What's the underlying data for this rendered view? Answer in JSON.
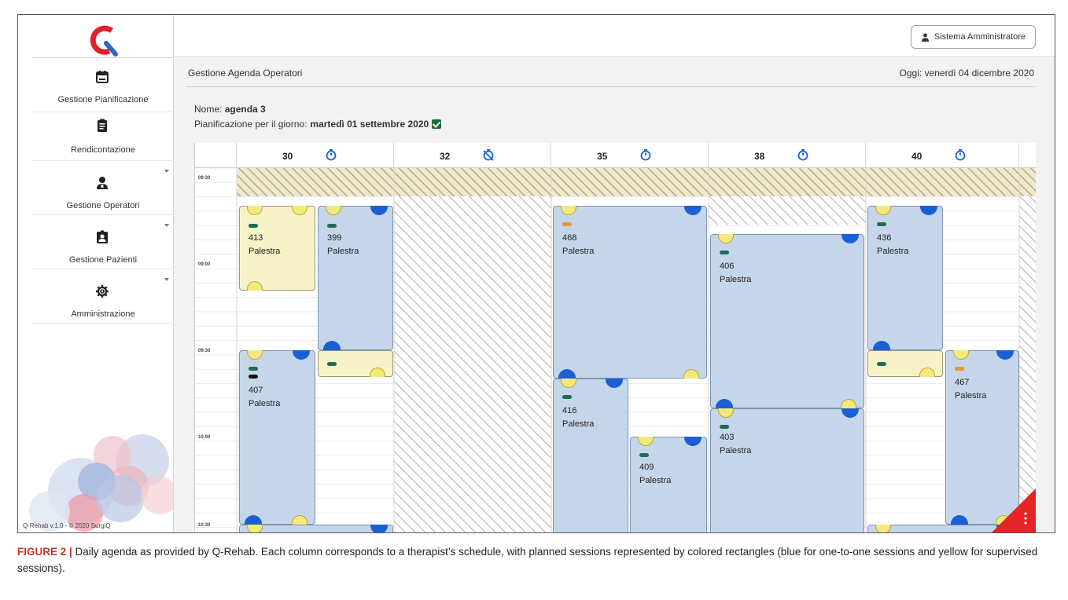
{
  "app": {
    "admin_button": "Sistema Amministratore"
  },
  "sidebar": {
    "items": [
      {
        "label": "Gestione Pianificazione",
        "icon": "calendar-icon",
        "has_caret": false
      },
      {
        "label": "Rendicontazione",
        "icon": "clipboard-icon",
        "has_caret": false
      },
      {
        "label": "Gestione Operatori",
        "icon": "operator-icon",
        "has_caret": true
      },
      {
        "label": "Gestione Pazienti",
        "icon": "patient-badge-icon",
        "has_caret": true
      },
      {
        "label": "Amministrazione",
        "icon": "gear-icon",
        "has_caret": true
      }
    ],
    "footer": "Q-Rehab v.1.0 - © 2020 SurgiQ"
  },
  "header": {
    "title": "Gestione Agenda Operatori",
    "today": "Oggi: venerdì 04 dicembre 2020"
  },
  "agenda": {
    "name_label": "Nome:",
    "name_value": "agenda 3",
    "plan_label": "Pianificazione per il giorno:",
    "plan_value": "martedì 01 settembre 2020",
    "times": [
      "09:30",
      "09:00",
      "09:30",
      "10:00",
      "10:30"
    ],
    "columns": [
      {
        "number": "30",
        "timer": "timer-icon"
      },
      {
        "number": "32",
        "timer": "timer-off-icon"
      },
      {
        "number": "35",
        "timer": "timer-icon"
      },
      {
        "number": "38",
        "timer": "timer-icon"
      },
      {
        "number": "40",
        "timer": "timer-icon"
      }
    ],
    "sessions": [
      {
        "code": "413",
        "place": "Palestra",
        "type": "yellow",
        "pills": [
          "green"
        ]
      },
      {
        "code": "399",
        "place": "Palestra",
        "type": "blue",
        "pills": [
          "green"
        ]
      },
      {
        "code": "407",
        "place": "Palestra",
        "type": "blue",
        "pills": [
          "green",
          "black"
        ]
      },
      {
        "code": "",
        "place": "",
        "type": "yellow",
        "pills": [
          "green"
        ]
      },
      {
        "code": "",
        "place": "",
        "type": "blue",
        "pills": []
      },
      {
        "code": "468",
        "place": "Palestra",
        "type": "blue",
        "pills": [
          "orange"
        ]
      },
      {
        "code": "416",
        "place": "Palestra",
        "type": "blue",
        "pills": [
          "green"
        ]
      },
      {
        "code": "409",
        "place": "Palestra",
        "type": "blue",
        "pills": [
          "green"
        ]
      },
      {
        "code": "406",
        "place": "Palestra",
        "type": "blue",
        "pills": [
          "green"
        ]
      },
      {
        "code": "403",
        "place": "Palestra",
        "type": "blue",
        "pills": [
          "green"
        ]
      },
      {
        "code": "436",
        "place": "Palestra",
        "type": "blue",
        "pills": [
          "green"
        ]
      },
      {
        "code": "",
        "place": "",
        "type": "yellow",
        "pills": [
          "green"
        ]
      },
      {
        "code": "467",
        "place": "Palestra",
        "type": "blue",
        "pills": [
          "orange"
        ]
      },
      {
        "code": "",
        "place": "",
        "type": "blue",
        "pills": []
      }
    ]
  },
  "caption": {
    "lead": "FIGURE 2 |",
    "text": " Daily agenda as provided by Q-Rehab. Each column corresponds to a therapist’s schedule, with planned sessions represented by colored rectangles (blue for one-to-one sessions and yellow for supervised sessions)."
  },
  "colors": {
    "blue_session": "#c5d6ea",
    "yellow_session": "#f7f3c8",
    "blue_cap": "#1a5fd6",
    "yellow_cap": "#f3e97a",
    "logo_red": "#e2202b",
    "logo_blue": "#2b66c9",
    "check_green": "#1f6b3a",
    "corner_red": "#e52525"
  }
}
